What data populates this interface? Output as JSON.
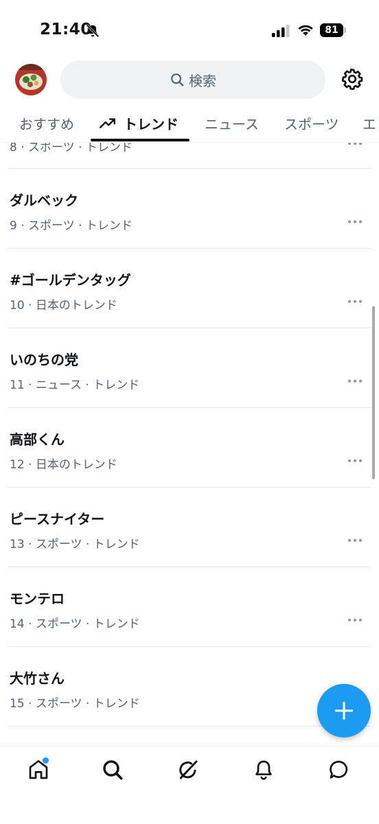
{
  "status_bar": {
    "time": "21:40",
    "battery": "81"
  },
  "header": {
    "search_placeholder": "検索",
    "icons": [
      "avatar",
      "search-icon",
      "gear-icon"
    ]
  },
  "tabs": [
    {
      "label": "おすすめ",
      "active": false
    },
    {
      "label": "トレンド",
      "active": true,
      "icon": "trending-icon"
    },
    {
      "label": "ニュース",
      "active": false
    },
    {
      "label": "スポーツ",
      "active": false
    },
    {
      "label": "エ",
      "active": false
    }
  ],
  "trends": {
    "partial_meta": "8 · スポーツ · トレンド",
    "items": [
      {
        "title": "ダルベック",
        "meta": "9 · スポーツ · トレンド"
      },
      {
        "title": "#ゴールデンタッグ",
        "meta": "10 · 日本のトレンド"
      },
      {
        "title": "いのちの党",
        "meta": "11 · ニュース · トレンド"
      },
      {
        "title": "高部くん",
        "meta": "12 · 日本のトレンド"
      },
      {
        "title": "ピースナイター",
        "meta": "13 · スポーツ · トレンド"
      },
      {
        "title": "モンテロ",
        "meta": "14 · スポーツ · トレンド"
      },
      {
        "title": "大竹さん",
        "meta": "15 · スポーツ · トレンド"
      }
    ]
  },
  "fab": {
    "icon": "plus-icon"
  },
  "bottom_nav": {
    "items": [
      "home-icon",
      "search-icon",
      "grok-icon",
      "bell-icon",
      "message-icon"
    ],
    "home_has_notification": true
  },
  "colors": {
    "accent": "#1d9bf0",
    "text_primary": "#0f1419",
    "text_secondary": "#536471",
    "search_bg": "#eff3f4"
  }
}
